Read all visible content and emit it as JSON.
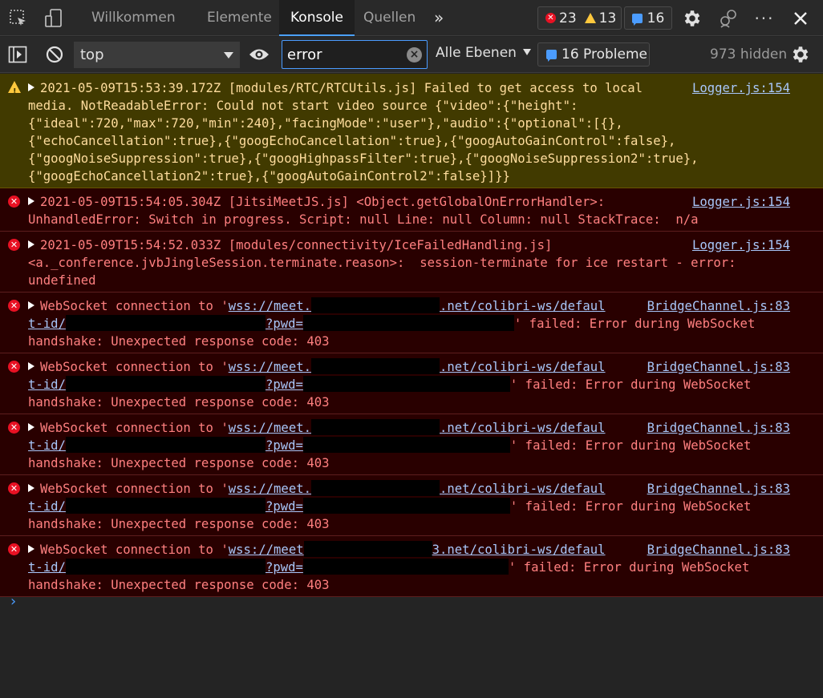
{
  "tabs": {
    "welcome": "Willkommen",
    "elements": "Elemente",
    "console": "Konsole",
    "sources": "Quellen",
    "more": "»"
  },
  "counts": {
    "errors": "23",
    "warnings": "13",
    "messages": "16"
  },
  "toolbar": {
    "context": "top",
    "filter_value": "error",
    "levels": "Alle Ebenen",
    "problems": "16 Probleme",
    "hidden": "973 hidden"
  },
  "colors": {
    "error": "#e81123",
    "warning": "#ffc83d",
    "accent": "#4b9cff",
    "link": "#a8c7fa"
  },
  "messages": [
    {
      "level": "warning",
      "source": "Logger.js:154",
      "lines": [
        "2021-05-09T15:53:39.172Z [modules/RTC/RTCUtils.js] Failed to get access to local",
        "media. NotReadableError: Could not start video source {\"video\":{\"height\":",
        "{\"ideal\":720,\"max\":720,\"min\":240},\"facingMode\":\"user\"},\"audio\":{\"optional\":[{},",
        "{\"echoCancellation\":true},{\"googEchoCancellation\":true},{\"googAutoGainControl\":false},",
        "{\"googNoiseSuppression\":true},{\"googHighpassFilter\":true},{\"googNoiseSuppression2\":true},",
        "{\"googEchoCancellation2\":true},{\"googAutoGainControl2\":false}]}}"
      ]
    },
    {
      "level": "error",
      "source": "Logger.js:154",
      "lines": [
        "2021-05-09T15:54:05.304Z [JitsiMeetJS.js] <Object.getGlobalOnErrorHandler>:",
        "UnhandledError: Switch in progress. Script: null Line: null Column: null StackTrace:  n/a"
      ]
    },
    {
      "level": "error",
      "source": "Logger.js:154",
      "lines": [
        "2021-05-09T15:54:52.033Z [modules/connectivity/IceFailedHandling.js]",
        "<a._conference.jvbJingleSession.terminate.reason>:  session-terminate for ice restart - error:",
        "undefined"
      ]
    }
  ],
  "ws_messages": [
    {
      "prefix": "WebSocket connection to '",
      "link_start": "wss://meet.",
      "link_end": ".net/colibri-ws/defaul",
      "line2_start": "t-id/",
      "line2_mid": "?pwd=",
      "line2_end": "' failed: Error during WebSocket",
      "line3": "handshake: Unexpected response code: 403",
      "source": "BridgeChannel.js:83"
    },
    {
      "prefix": "WebSocket connection to '",
      "link_start": "wss://meet.",
      "link_end": ".net/colibri-ws/defaul",
      "line2_start": "t-id/",
      "line2_mid": "?pwd=",
      "line2_end": "' failed: Error during WebSocket",
      "line3": "handshake: Unexpected response code: 403",
      "source": "BridgeChannel.js:83"
    },
    {
      "prefix": "WebSocket connection to '",
      "link_start": "wss://meet.",
      "link_end": ".net/colibri-ws/defaul",
      "line2_start": "t-id/",
      "line2_mid": "?pwd=",
      "line2_end": "' failed: Error during WebSocket",
      "line3": "handshake: Unexpected response code: 403",
      "source": "BridgeChannel.js:83"
    },
    {
      "prefix": "WebSocket connection to '",
      "link_start": "wss://meet.",
      "link_end": ".net/colibri-ws/defaul",
      "line2_start": "t-id/",
      "line2_mid": "?pwd=",
      "line2_end": "' failed: Error during WebSocket",
      "line3": "handshake: Unexpected response code: 403",
      "source": "BridgeChannel.js:83"
    },
    {
      "prefix": "WebSocket connection to '",
      "link_start": "wss://meet",
      "link_end": "3.net/colibri-ws/defaul",
      "line2_start": "t-id/",
      "line2_mid": "?pwd=",
      "line2_end": "' failed: Error during WebSocket",
      "line3": "handshake: Unexpected response code: 403",
      "source": "BridgeChannel.js:83"
    }
  ],
  "prompt": "›"
}
